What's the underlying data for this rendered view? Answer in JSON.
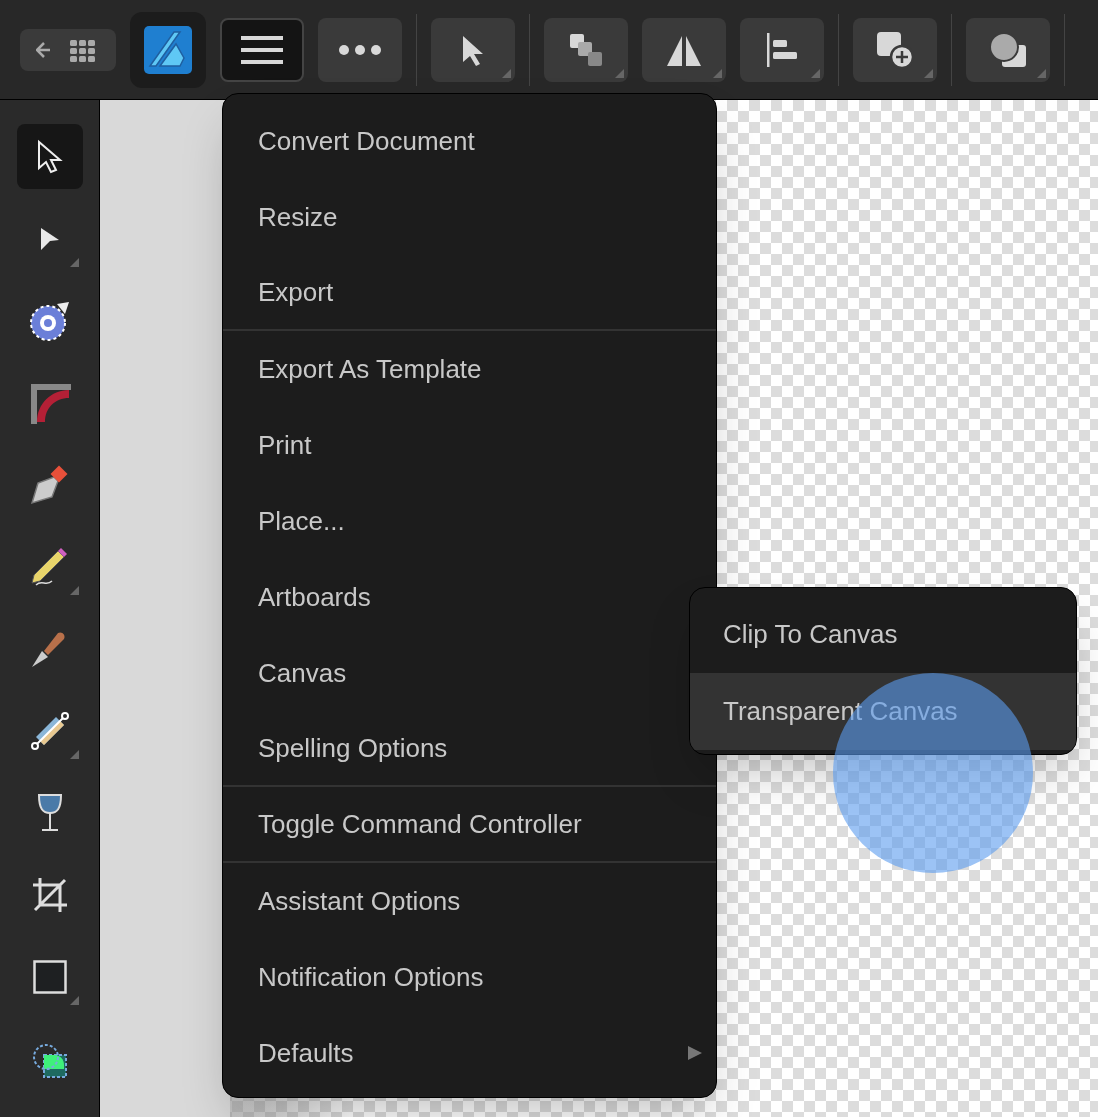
{
  "toolbar": [
    {
      "kind": "back-grid",
      "selected": false,
      "flyout": false
    },
    {
      "kind": "logo",
      "selected": false,
      "flyout": false
    },
    {
      "kind": "menu",
      "selected": true,
      "flyout": false
    },
    {
      "kind": "more",
      "selected": false,
      "flyout": false
    },
    {
      "kind": "pointer",
      "selected": false,
      "flyout": true
    },
    {
      "kind": "arrange",
      "selected": false,
      "flyout": true
    },
    {
      "kind": "flip",
      "selected": false,
      "flyout": true
    },
    {
      "kind": "align",
      "selected": false,
      "flyout": true
    },
    {
      "kind": "add",
      "selected": false,
      "flyout": true
    },
    {
      "kind": "shapes",
      "selected": false,
      "flyout": true
    }
  ],
  "tools": [
    {
      "kind": "move",
      "selected": true,
      "flyout": false
    },
    {
      "kind": "node",
      "selected": false,
      "flyout": true
    },
    {
      "kind": "contour",
      "selected": false,
      "flyout": false
    },
    {
      "kind": "corner",
      "selected": false,
      "flyout": false
    },
    {
      "kind": "pen",
      "selected": false,
      "flyout": false
    },
    {
      "kind": "pencil",
      "selected": false,
      "flyout": true
    },
    {
      "kind": "brush",
      "selected": false,
      "flyout": false
    },
    {
      "kind": "gradient",
      "selected": false,
      "flyout": true
    },
    {
      "kind": "transparency",
      "selected": false,
      "flyout": false
    },
    {
      "kind": "crop",
      "selected": false,
      "flyout": false
    },
    {
      "kind": "rectangle",
      "selected": false,
      "flyout": true
    },
    {
      "kind": "selection",
      "selected": false,
      "flyout": false
    }
  ],
  "menu": {
    "items": [
      {
        "label": "Convert Document",
        "submenu": false,
        "divider_after": false
      },
      {
        "label": "Resize",
        "submenu": false,
        "divider_after": false
      },
      {
        "label": "Export",
        "submenu": false,
        "divider_after": true
      },
      {
        "label": "Export As Template",
        "submenu": false,
        "divider_after": false
      },
      {
        "label": "Print",
        "submenu": false,
        "divider_after": false
      },
      {
        "label": "Place...",
        "submenu": false,
        "divider_after": false
      },
      {
        "label": "Artboards",
        "submenu": false,
        "divider_after": false
      },
      {
        "label": "Canvas",
        "submenu": false,
        "divider_after": false
      },
      {
        "label": "Spelling Options",
        "submenu": false,
        "divider_after": true
      },
      {
        "label": "Toggle Command Controller",
        "submenu": false,
        "divider_after": true
      },
      {
        "label": "Assistant Options",
        "submenu": false,
        "divider_after": false
      },
      {
        "label": "Notification Options",
        "submenu": false,
        "divider_after": false
      },
      {
        "label": "Defaults",
        "submenu": true,
        "divider_after": false
      }
    ]
  },
  "submenu": {
    "items": [
      {
        "label": "Clip To Canvas",
        "selected": false
      },
      {
        "label": "Transparent Canvas",
        "selected": true
      }
    ]
  }
}
